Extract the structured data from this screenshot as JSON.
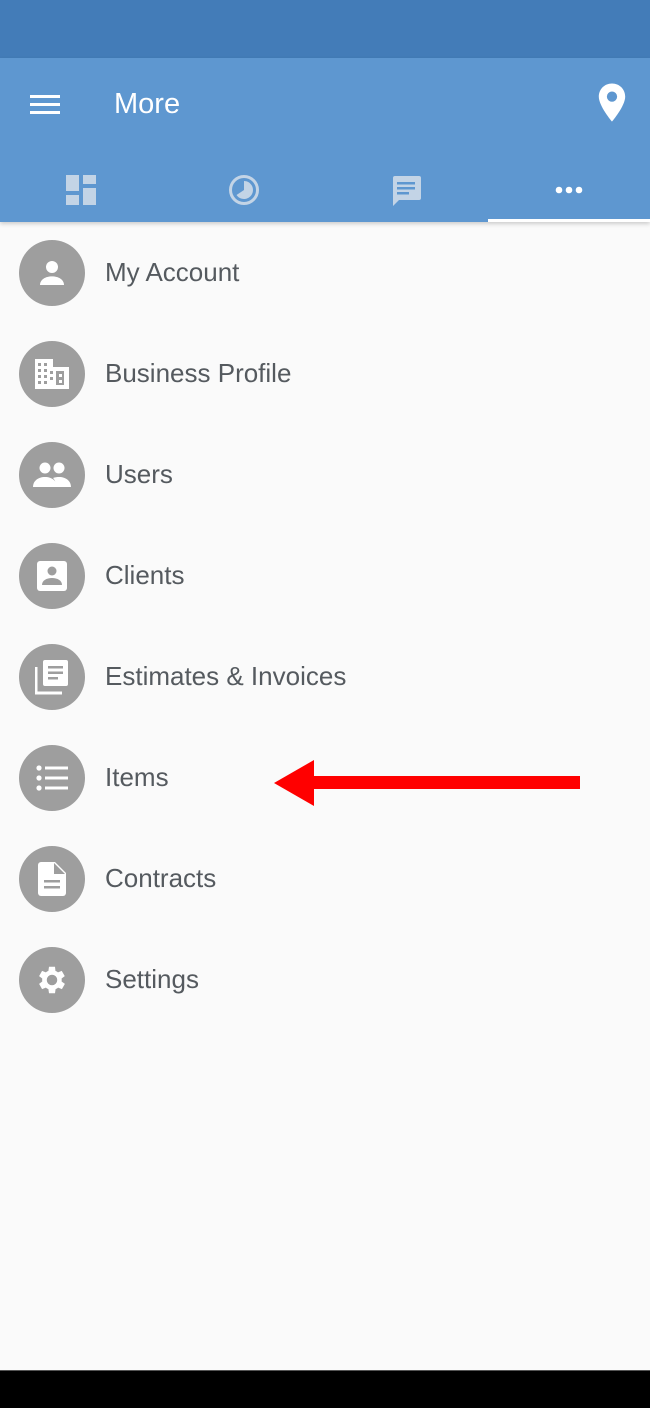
{
  "app_bar": {
    "title": "More",
    "menu_icon": "hamburger-menu-icon",
    "action_icon": "location-pin-icon",
    "background_color": "#5e97d0",
    "status_bar_color": "#437cb8"
  },
  "tabs": [
    {
      "name": "dashboard",
      "icon": "dashboard-icon",
      "active": false
    },
    {
      "name": "history",
      "icon": "clock-icon",
      "active": false
    },
    {
      "name": "messages",
      "icon": "message-icon",
      "active": false
    },
    {
      "name": "more",
      "icon": "more-horizontal-icon",
      "active": true
    }
  ],
  "menu": {
    "items": [
      {
        "label": "My Account",
        "icon": "person-icon"
      },
      {
        "label": "Business Profile",
        "icon": "building-icon"
      },
      {
        "label": "Users",
        "icon": "people-icon"
      },
      {
        "label": "Clients",
        "icon": "contact-card-icon"
      },
      {
        "label": "Estimates & Invoices",
        "icon": "documents-icon"
      },
      {
        "label": "Items",
        "icon": "list-icon"
      },
      {
        "label": "Contracts",
        "icon": "document-icon"
      },
      {
        "label": "Settings",
        "icon": "gear-icon"
      }
    ]
  },
  "annotation": {
    "type": "arrow",
    "points_to": "Items",
    "color": "#ff0000"
  }
}
